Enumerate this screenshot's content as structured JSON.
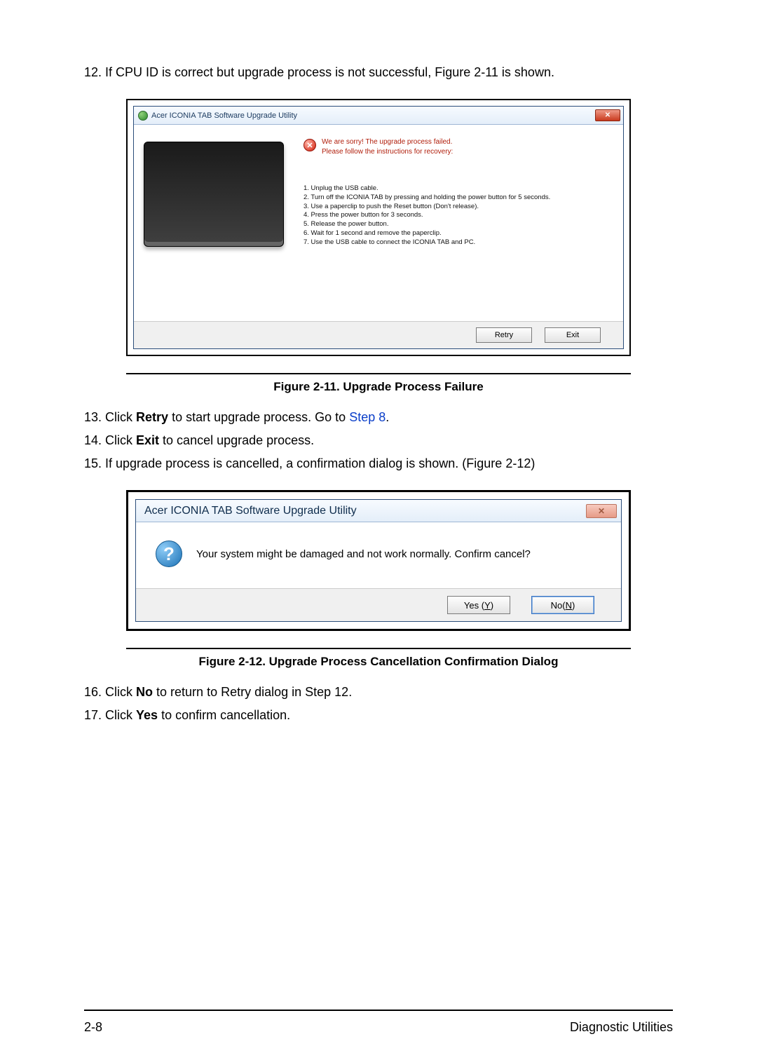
{
  "step12": "12. If CPU ID is correct but upgrade process is not successful, Figure 2-11 is shown.",
  "window1": {
    "title": "Acer ICONIA TAB Software Upgrade Utility",
    "fail_line1": "We are sorry! The upgrade process failed.",
    "fail_line2": "Please follow the instructions for recovery:",
    "instr": {
      "i1": "1. Unplug the USB cable.",
      "i2": "2. Turn off the ICONIA TAB by pressing and holding the power button for 5 seconds.",
      "i3": "3. Use a paperclip to push the Reset button (Don't release).",
      "i4": "4. Press the power button for 3 seconds.",
      "i5": "5. Release the power button.",
      "i6": "6. Wait for 1 second and remove the paperclip.",
      "i7": "7. Use the USB cable to connect the ICONIA TAB  and PC."
    },
    "retry": "Retry",
    "exit": "Exit"
  },
  "caption1": "Figure 2-11.   Upgrade Process Failure",
  "step13_a": "13. Click ",
  "step13_b": "Retry",
  "step13_c": " to start upgrade process. Go to ",
  "step13_link": "Step 8",
  "step13_d": ".",
  "step14_a": "14. Click ",
  "step14_b": "Exit",
  "step14_c": " to cancel upgrade process.",
  "step15": "15. If upgrade process is cancelled, a confirmation dialog is shown. (Figure 2-12)",
  "dialog": {
    "title": "Acer ICONIA TAB Software Upgrade Utility",
    "msg": "Your system might be damaged and not work normally. Confirm cancel?",
    "yes_pre": "Yes (",
    "yes_u": "Y",
    "yes_post": ")",
    "no_pre": "No(",
    "no_u": "N",
    "no_post": ")"
  },
  "caption2": "Figure 2-12.   Upgrade Process Cancellation Confirmation Dialog",
  "step16_a": "16. Click ",
  "step16_b": "No",
  "step16_c": " to return to Retry dialog in Step 12.",
  "step17_a": "17. Click ",
  "step17_b": "Yes",
  "step17_c": " to confirm cancellation.",
  "footer_left": "2-8",
  "footer_right": "Diagnostic Utilities"
}
